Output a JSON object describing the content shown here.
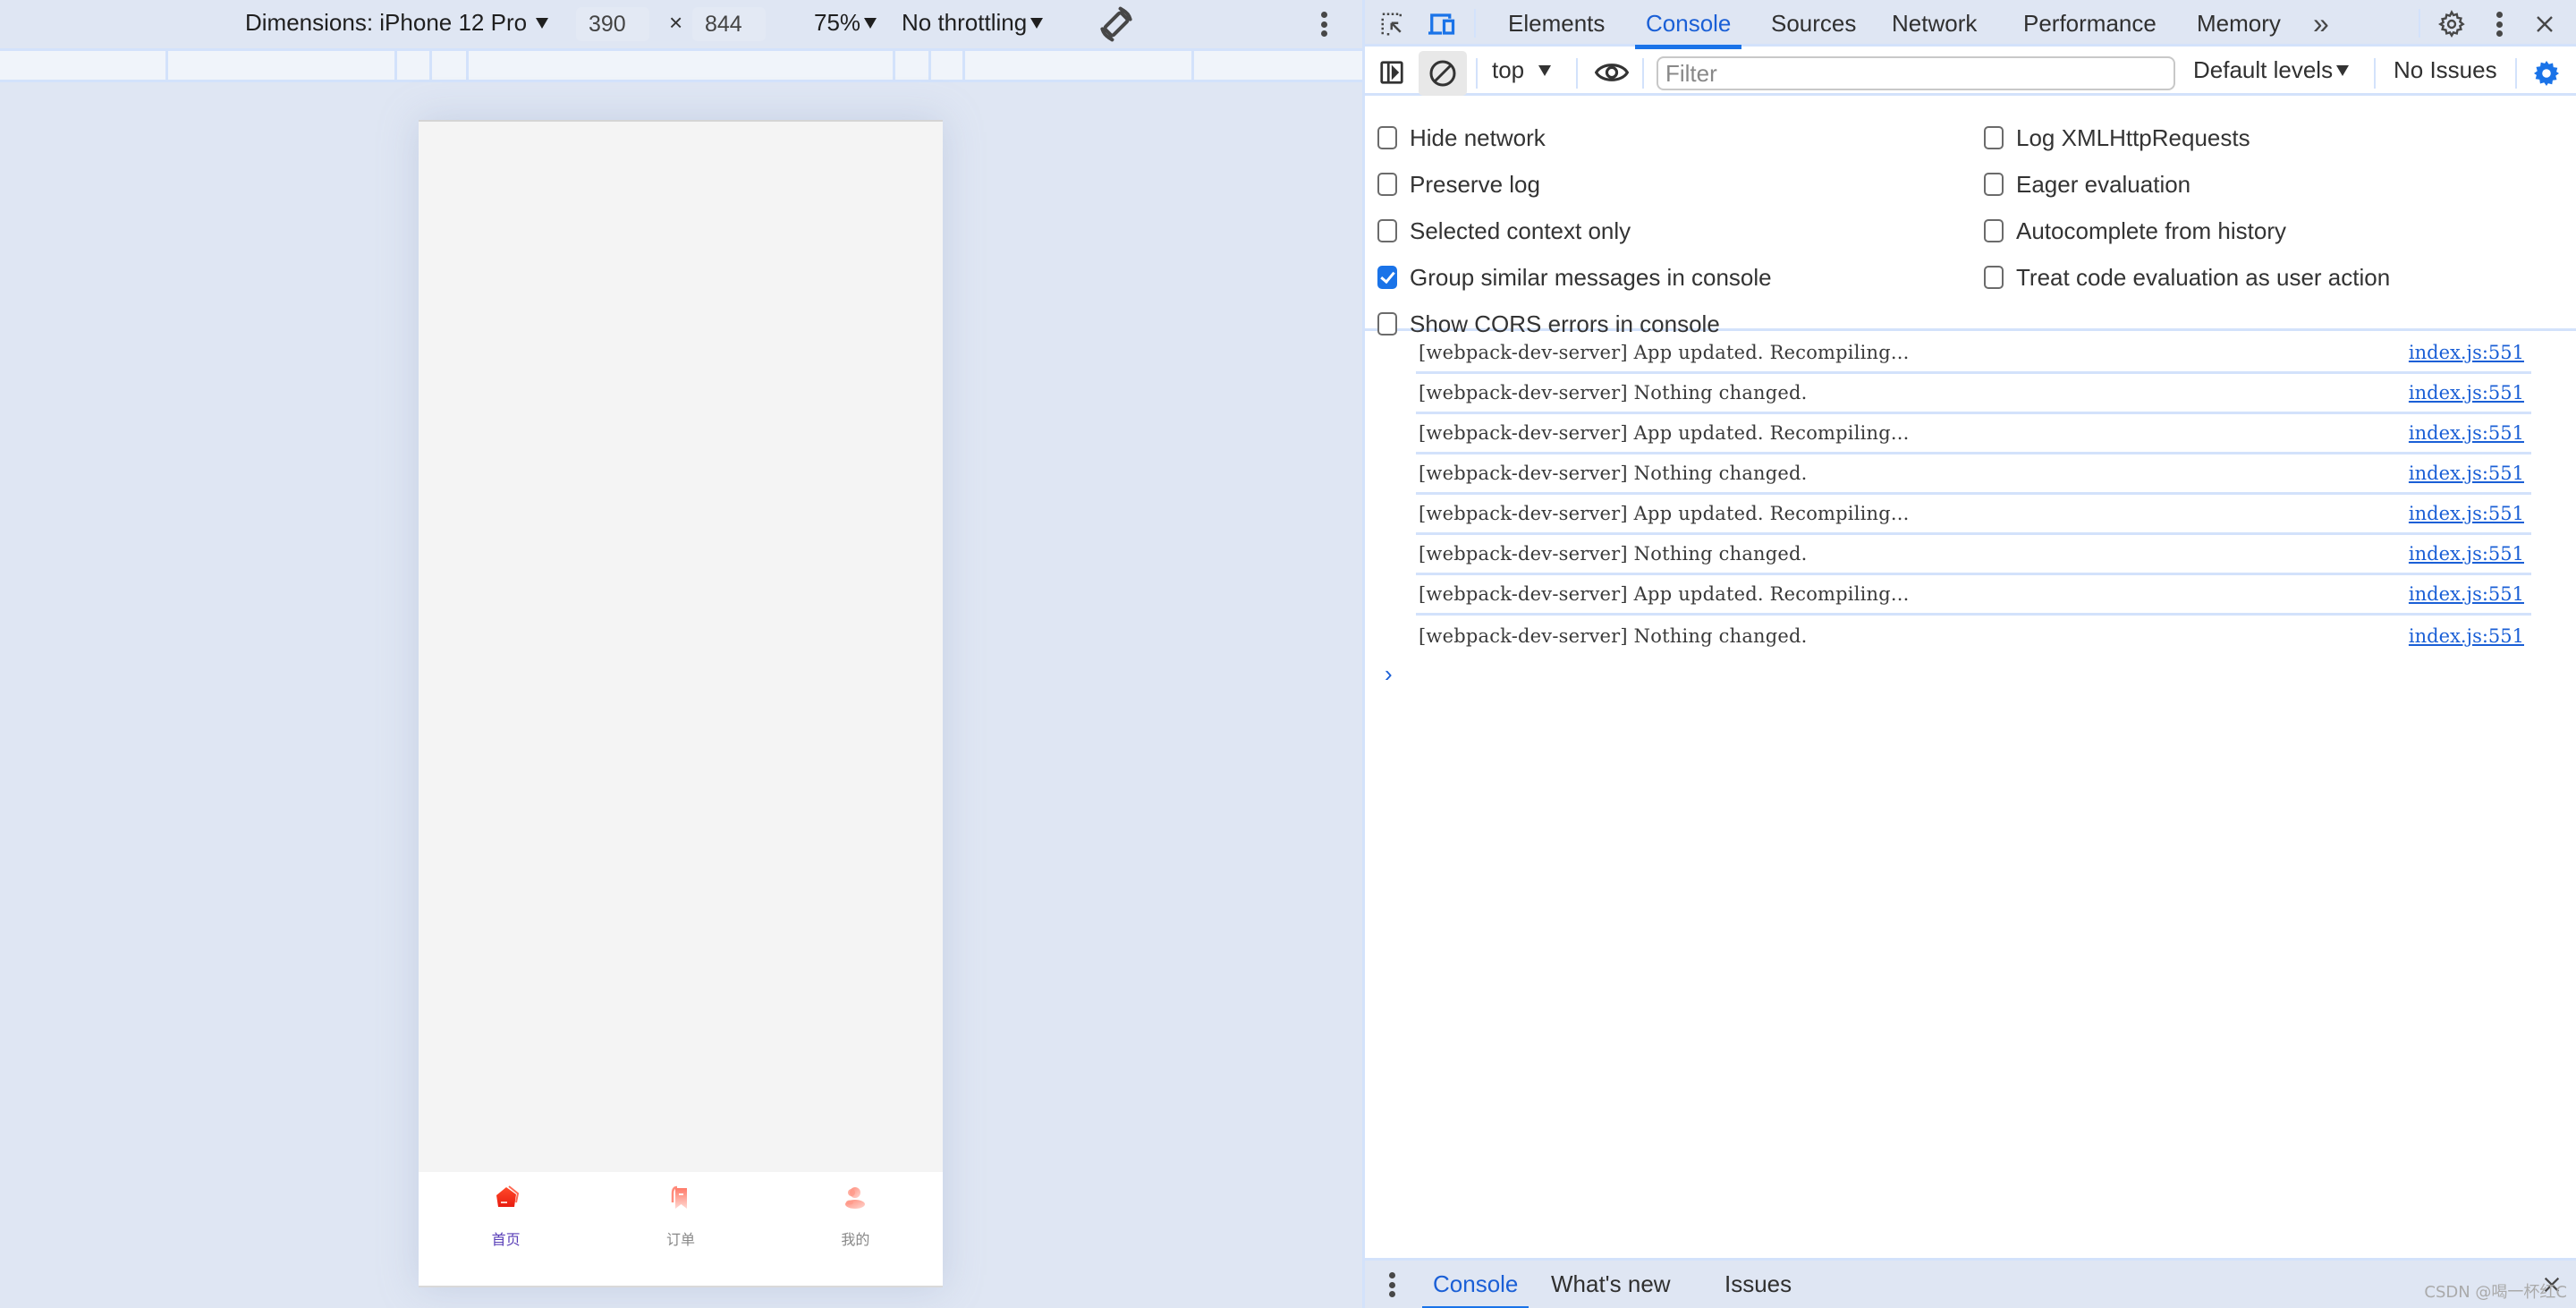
{
  "device_toolbar": {
    "dimensions_label": "Dimensions: iPhone 12 Pro",
    "width": "390",
    "height": "844",
    "times": "×",
    "zoom": "75%",
    "throttling": "No throttling"
  },
  "device_screen": {
    "tabbar": [
      {
        "label": "首页",
        "icon": "home-icon",
        "active": true
      },
      {
        "label": "订单",
        "icon": "order-icon",
        "active": false
      },
      {
        "label": "我的",
        "icon": "user-icon",
        "active": false
      }
    ]
  },
  "devtools": {
    "tabs": [
      {
        "label": "Elements",
        "active": false
      },
      {
        "label": "Console",
        "active": true
      },
      {
        "label": "Sources",
        "active": false
      },
      {
        "label": "Network",
        "active": false
      },
      {
        "label": "Performance",
        "active": false
      },
      {
        "label": "Memory",
        "active": false
      }
    ],
    "more_tabs": "»",
    "console_toolbar": {
      "context": "top",
      "filter_placeholder": "Filter",
      "levels": "Default levels",
      "issues": "No Issues"
    },
    "settings_left": [
      {
        "label": "Hide network",
        "checked": false
      },
      {
        "label": "Preserve log",
        "checked": false
      },
      {
        "label": "Selected context only",
        "checked": false
      },
      {
        "label": "Group similar messages in console",
        "checked": true
      },
      {
        "label": "Show CORS errors in console",
        "checked": false
      }
    ],
    "settings_right": [
      {
        "label": "Log XMLHttpRequests",
        "checked": false
      },
      {
        "label": "Eager evaluation",
        "checked": false
      },
      {
        "label": "Autocomplete from history",
        "checked": false
      },
      {
        "label": "Treat code evaluation as user action",
        "checked": false
      }
    ],
    "logs": [
      {
        "message": "[webpack-dev-server] App updated. Recompiling...",
        "source": "index.js:551"
      },
      {
        "message": "[webpack-dev-server] Nothing changed.",
        "source": "index.js:551"
      },
      {
        "message": "[webpack-dev-server] App updated. Recompiling...",
        "source": "index.js:551"
      },
      {
        "message": "[webpack-dev-server] Nothing changed.",
        "source": "index.js:551"
      },
      {
        "message": "[webpack-dev-server] App updated. Recompiling...",
        "source": "index.js:551"
      },
      {
        "message": "[webpack-dev-server] Nothing changed.",
        "source": "index.js:551"
      },
      {
        "message": "[webpack-dev-server] App updated. Recompiling...",
        "source": "index.js:551"
      },
      {
        "message": "[webpack-dev-server] Nothing changed.",
        "source": "index.js:551"
      }
    ],
    "prompt": "›",
    "drawer_tabs": [
      {
        "label": "Console",
        "active": true
      },
      {
        "label": "What's new",
        "active": false
      },
      {
        "label": "Issues",
        "active": false
      }
    ],
    "watermark": "CSDN @喝一杯红C"
  },
  "colors": {
    "accent": "#1a73e8",
    "tab_active_label": "#5a3fb8",
    "icon_red": "#f0311b"
  }
}
